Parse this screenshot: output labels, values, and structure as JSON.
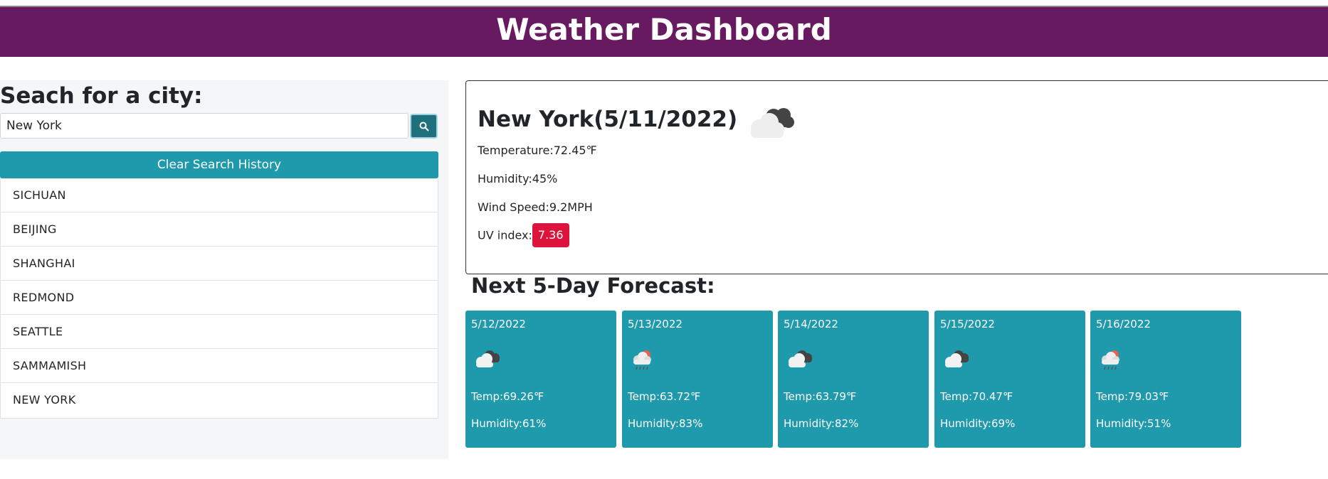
{
  "header": {
    "title": "Weather Dashboard"
  },
  "sidebar": {
    "heading": "Seach for a city:",
    "search_value": "New York",
    "search_icon": "search-icon",
    "clear_label": "Clear Search History",
    "history": [
      "SICHUAN",
      "BEIJING",
      "SHANGHAI",
      "REDMOND",
      "SEATTLE",
      "SAMMAMISH",
      "NEW YORK"
    ]
  },
  "current": {
    "title": "New York(5/11/2022)",
    "icon": "partly-cloudy-icon",
    "temperature_label": "Temperature:",
    "temperature": "72.45℉",
    "humidity_label": "Humidity:",
    "humidity": "45%",
    "wind_label": "Wind Speed:",
    "wind": "9.2MPH",
    "uv_label": "UV index:",
    "uv": "7.36",
    "uv_color": "#dc143c"
  },
  "forecast": {
    "title": "Next 5-Day Forecast:",
    "temp_label": "Temp:",
    "humidity_label": "Humidity:",
    "days": [
      {
        "date": "5/12/2022",
        "icon": "cloudy-icon",
        "temp": "69.26℉",
        "humidity": "61%"
      },
      {
        "date": "5/13/2022",
        "icon": "rain-icon",
        "temp": "63.72℉",
        "humidity": "83%"
      },
      {
        "date": "5/14/2022",
        "icon": "cloudy-icon",
        "temp": "63.79℉",
        "humidity": "82%"
      },
      {
        "date": "5/15/2022",
        "icon": "cloudy-icon",
        "temp": "70.47℉",
        "humidity": "69%"
      },
      {
        "date": "5/16/2022",
        "icon": "rain-icon",
        "temp": "79.03℉",
        "humidity": "51%"
      }
    ]
  },
  "colors": {
    "header": "#671a5f",
    "accent": "#1e9aac",
    "search_button": "#1f6f7c"
  }
}
